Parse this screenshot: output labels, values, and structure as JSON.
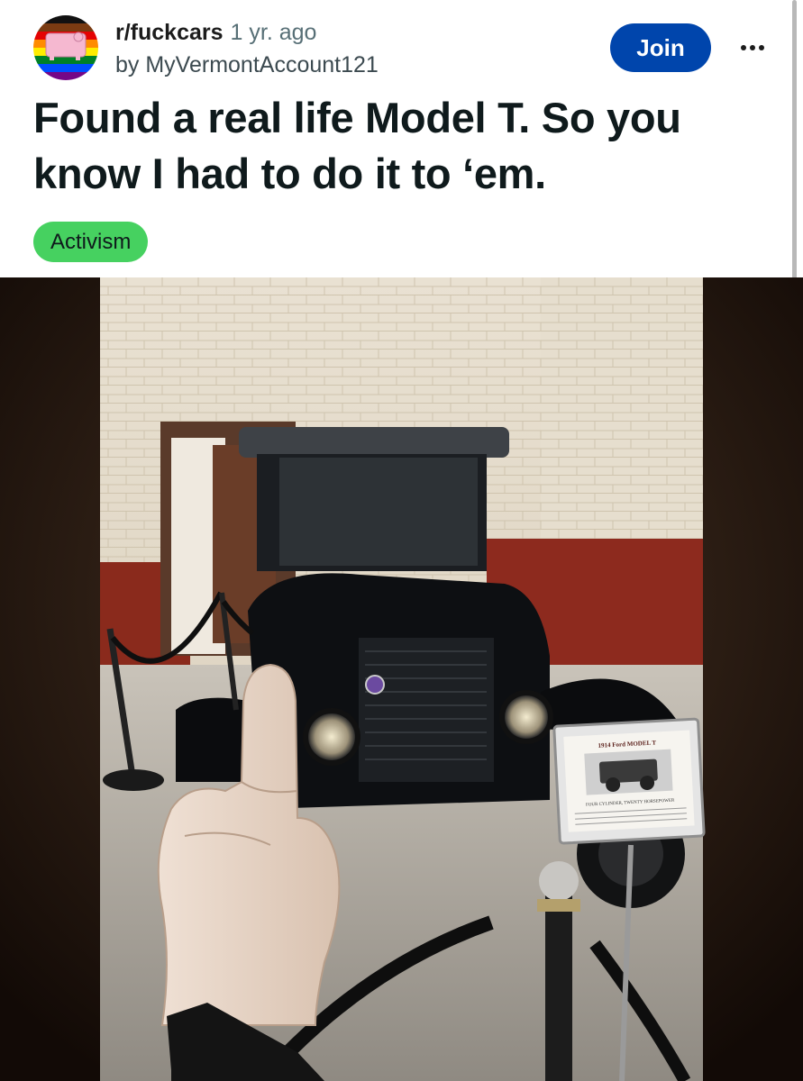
{
  "post": {
    "subreddit": "r/fuckcars",
    "age": "1 yr. ago",
    "author_line": "by MyVermontAccount121",
    "join_label": "Join",
    "title": "Found a real life Model T. So you know I had to do it to ‘em.",
    "flair": "Activism"
  },
  "placard": {
    "heading": "1914 Ford MODEL T",
    "caption": "FOUR CYLINDER, TWENTY HORSEPOWER"
  },
  "icons": {
    "avatar": "subreddit-avatar-icon",
    "more": "more-options-icon"
  },
  "colors": {
    "join": "#0045ac",
    "flair": "#46d160",
    "title": "#0f1a1c"
  }
}
